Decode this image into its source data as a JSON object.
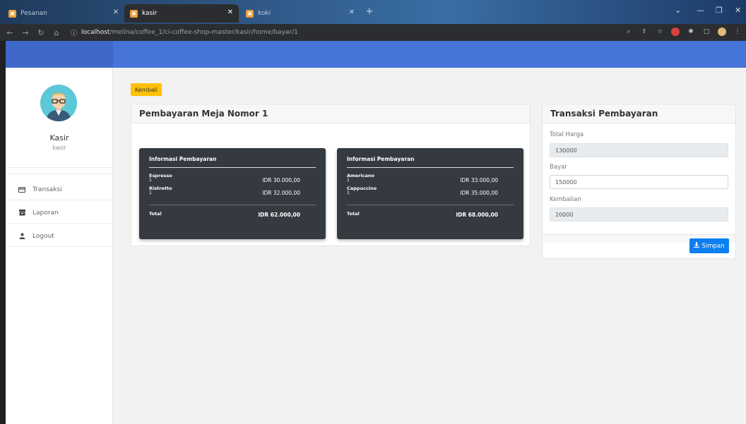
{
  "browser": {
    "tabs": [
      {
        "title": "Pesanan",
        "active": false
      },
      {
        "title": "kasir",
        "active": true
      },
      {
        "title": "koki",
        "active": false
      }
    ],
    "url_host": "localhost",
    "url_path": "/melina/coffee_1/ci-coffee-shop-master/kasir/home/bayar/1"
  },
  "sidebar": {
    "user_name": "Kasir",
    "user_role": "kasir",
    "items": [
      {
        "label": "Transaksi",
        "icon": "card-icon"
      },
      {
        "label": "Laporan",
        "icon": "inbox-icon"
      },
      {
        "label": "Logout",
        "icon": "user-icon"
      }
    ]
  },
  "main": {
    "back_label": "Kembali",
    "payment_title": "Pembayaran Meja Nomor 1",
    "orders": [
      {
        "title": "Informasi Pembayaran",
        "items": [
          {
            "name": "Espresso",
            "qty": "1",
            "price": "IDR 30.000,00"
          },
          {
            "name": "Ristretto",
            "qty": "1",
            "price": "IDR 32.000,00"
          }
        ],
        "total_label": "Total",
        "total_value": "IDR 62.000,00"
      },
      {
        "title": "Informasi Pembayaran",
        "items": [
          {
            "name": "Americano",
            "qty": "1",
            "price": "IDR 33.000,00"
          },
          {
            "name": "Cappuccino",
            "qty": "1",
            "price": "IDR 35.000,00"
          }
        ],
        "total_label": "Total",
        "total_value": "IDR 68.000,00"
      }
    ]
  },
  "transaction": {
    "title": "Transaksi Pembayaran",
    "total_label": "Total Harga",
    "total_value": "130000",
    "pay_label": "Bayar",
    "pay_value": "150000",
    "change_label": "Kembalian",
    "change_value": "20000",
    "save_label": "Simpan"
  },
  "colors": {
    "topbar": "#4674d8",
    "kembali_button": "#ffc107",
    "simpan_button": "#0d7ff0",
    "dark_card": "#343a40"
  }
}
